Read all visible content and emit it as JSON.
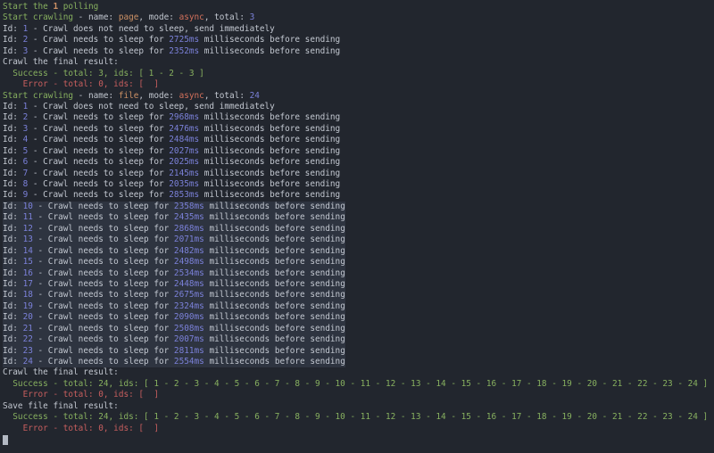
{
  "terminal": {
    "colors": {
      "background": "#22262e",
      "selection": "#2e3440",
      "text": "#c2c7d0",
      "green": "#87b05f",
      "orange": "#cd9165",
      "async": "#d3705b",
      "number": "#7b81d9",
      "red": "#c75e5e",
      "cursor": "#b3b9c3"
    },
    "lines": [
      {
        "segments": [
          {
            "text": "Start the ",
            "color": "green"
          },
          {
            "text": "1",
            "color": "orange",
            "bold": true
          },
          {
            "text": " polling",
            "color": "green"
          }
        ]
      },
      {
        "segments": [
          {
            "text": "Start crawling",
            "color": "green"
          },
          {
            "text": " - name: ",
            "color": "text"
          },
          {
            "text": "page",
            "color": "orange"
          },
          {
            "text": ", mode: ",
            "color": "text"
          },
          {
            "text": "async",
            "color": "async"
          },
          {
            "text": ", total: ",
            "color": "text"
          },
          {
            "text": "3",
            "color": "number"
          }
        ]
      },
      {
        "segments": [
          {
            "text": "Id: ",
            "color": "text"
          },
          {
            "text": "1",
            "color": "number"
          },
          {
            "text": " - Crawl does not need to sleep, send immediately",
            "color": "text"
          }
        ]
      },
      {
        "segments": [
          {
            "text": "Id: ",
            "color": "text"
          },
          {
            "text": "2",
            "color": "number"
          },
          {
            "text": " - Crawl needs to sleep for ",
            "color": "text"
          },
          {
            "text": "2725ms",
            "color": "number"
          },
          {
            "text": " milliseconds before sending",
            "color": "text"
          }
        ]
      },
      {
        "segments": [
          {
            "text": "Id: ",
            "color": "text"
          },
          {
            "text": "3",
            "color": "number"
          },
          {
            "text": " - Crawl needs to sleep for ",
            "color": "text"
          },
          {
            "text": "2352ms",
            "color": "number"
          },
          {
            "text": " milliseconds before sending",
            "color": "text"
          }
        ]
      },
      {
        "segments": [
          {
            "text": "Crawl the final result:",
            "color": "text"
          }
        ]
      },
      {
        "segments": [
          {
            "text": "  Success - total: 3, ids: [ 1 - 2 - 3 ]",
            "color": "green"
          }
        ]
      },
      {
        "segments": [
          {
            "text": "    Error - total: 0, ids: [  ]",
            "color": "red"
          }
        ]
      },
      {
        "segments": [
          {
            "text": "Start crawling",
            "color": "green"
          },
          {
            "text": " - name: ",
            "color": "text"
          },
          {
            "text": "file",
            "color": "orange"
          },
          {
            "text": ", mode: ",
            "color": "text"
          },
          {
            "text": "async",
            "color": "async"
          },
          {
            "text": ", total: ",
            "color": "text"
          },
          {
            "text": "24",
            "color": "number"
          }
        ]
      },
      {
        "segments": [
          {
            "text": "Id: ",
            "color": "text"
          },
          {
            "text": "1",
            "color": "number"
          },
          {
            "text": " - Crawl does not need to sleep, send immediately",
            "color": "text"
          }
        ]
      },
      {
        "segments": [
          {
            "text": "Id: ",
            "color": "text"
          },
          {
            "text": "2",
            "color": "number"
          },
          {
            "text": " - Crawl needs to sleep for ",
            "color": "text"
          },
          {
            "text": "2968ms",
            "color": "number"
          },
          {
            "text": " milliseconds before sending",
            "color": "text"
          }
        ]
      },
      {
        "segments": [
          {
            "text": "Id: ",
            "color": "text"
          },
          {
            "text": "3",
            "color": "number"
          },
          {
            "text": " - Crawl needs to sleep for ",
            "color": "text"
          },
          {
            "text": "2476ms",
            "color": "number"
          },
          {
            "text": " milliseconds before sending",
            "color": "text"
          }
        ]
      },
      {
        "segments": [
          {
            "text": "Id: ",
            "color": "text"
          },
          {
            "text": "4",
            "color": "number"
          },
          {
            "text": " - Crawl needs to sleep for ",
            "color": "text"
          },
          {
            "text": "2484ms",
            "color": "number"
          },
          {
            "text": " milliseconds before sending",
            "color": "text"
          }
        ]
      },
      {
        "segments": [
          {
            "text": "Id: ",
            "color": "text"
          },
          {
            "text": "5",
            "color": "number"
          },
          {
            "text": " - Crawl needs to sleep for ",
            "color": "text"
          },
          {
            "text": "2027ms",
            "color": "number"
          },
          {
            "text": " milliseconds before sending",
            "color": "text"
          }
        ]
      },
      {
        "segments": [
          {
            "text": "Id: ",
            "color": "text"
          },
          {
            "text": "6",
            "color": "number"
          },
          {
            "text": " - Crawl needs to sleep for ",
            "color": "text"
          },
          {
            "text": "2025ms",
            "color": "number"
          },
          {
            "text": " milliseconds before sending",
            "color": "text"
          }
        ]
      },
      {
        "segments": [
          {
            "text": "Id: ",
            "color": "text"
          },
          {
            "text": "7",
            "color": "number"
          },
          {
            "text": " - Crawl needs to sleep for ",
            "color": "text"
          },
          {
            "text": "2145ms",
            "color": "number"
          },
          {
            "text": " milliseconds before sending",
            "color": "text"
          }
        ]
      },
      {
        "segments": [
          {
            "text": "Id: ",
            "color": "text"
          },
          {
            "text": "8",
            "color": "number"
          },
          {
            "text": " - Crawl needs to sleep for ",
            "color": "text"
          },
          {
            "text": "2035ms",
            "color": "number"
          },
          {
            "text": " milliseconds before sending",
            "color": "text"
          }
        ]
      },
      {
        "segments": [
          {
            "text": "Id: ",
            "color": "text"
          },
          {
            "text": "9",
            "color": "number"
          },
          {
            "text": " - Crawl needs to sleep for ",
            "color": "text"
          },
          {
            "text": "2853ms",
            "color": "number"
          },
          {
            "text": " milliseconds before sending",
            "color": "text"
          }
        ]
      },
      {
        "selected": true,
        "segments": [
          {
            "text": "Id: ",
            "color": "text"
          },
          {
            "text": "10",
            "color": "number"
          },
          {
            "text": " - Crawl needs to sleep for ",
            "color": "text"
          },
          {
            "text": "2358ms",
            "color": "number"
          },
          {
            "text": " milliseconds before sending",
            "color": "text"
          }
        ]
      },
      {
        "selected": true,
        "segments": [
          {
            "text": "Id: ",
            "color": "text"
          },
          {
            "text": "11",
            "color": "number"
          },
          {
            "text": " - Crawl needs to sleep for ",
            "color": "text"
          },
          {
            "text": "2435ms",
            "color": "number"
          },
          {
            "text": " milliseconds before sending",
            "color": "text"
          }
        ]
      },
      {
        "selected": true,
        "segments": [
          {
            "text": "Id: ",
            "color": "text"
          },
          {
            "text": "12",
            "color": "number"
          },
          {
            "text": " - Crawl needs to sleep for ",
            "color": "text"
          },
          {
            "text": "2868ms",
            "color": "number"
          },
          {
            "text": " milliseconds before sending",
            "color": "text"
          }
        ]
      },
      {
        "selected": true,
        "segments": [
          {
            "text": "Id: ",
            "color": "text"
          },
          {
            "text": "13",
            "color": "number"
          },
          {
            "text": " - Crawl needs to sleep for ",
            "color": "text"
          },
          {
            "text": "2071ms",
            "color": "number"
          },
          {
            "text": " milliseconds before sending",
            "color": "text"
          }
        ]
      },
      {
        "selected": true,
        "segments": [
          {
            "text": "Id: ",
            "color": "text"
          },
          {
            "text": "14",
            "color": "number"
          },
          {
            "text": " - Crawl needs to sleep for ",
            "color": "text"
          },
          {
            "text": "2482ms",
            "color": "number"
          },
          {
            "text": " milliseconds before sending",
            "color": "text"
          }
        ]
      },
      {
        "selected": true,
        "segments": [
          {
            "text": "Id: ",
            "color": "text"
          },
          {
            "text": "15",
            "color": "number"
          },
          {
            "text": " - Crawl needs to sleep for ",
            "color": "text"
          },
          {
            "text": "2498ms",
            "color": "number"
          },
          {
            "text": " milliseconds before sending",
            "color": "text"
          }
        ]
      },
      {
        "selected": true,
        "segments": [
          {
            "text": "Id: ",
            "color": "text"
          },
          {
            "text": "16",
            "color": "number"
          },
          {
            "text": " - Crawl needs to sleep for ",
            "color": "text"
          },
          {
            "text": "2534ms",
            "color": "number"
          },
          {
            "text": " milliseconds before sending",
            "color": "text"
          }
        ]
      },
      {
        "selected": true,
        "segments": [
          {
            "text": "Id: ",
            "color": "text"
          },
          {
            "text": "17",
            "color": "number"
          },
          {
            "text": " - Crawl needs to sleep for ",
            "color": "text"
          },
          {
            "text": "2448ms",
            "color": "number"
          },
          {
            "text": " milliseconds before sending",
            "color": "text"
          }
        ]
      },
      {
        "selected": true,
        "segments": [
          {
            "text": "Id: ",
            "color": "text"
          },
          {
            "text": "18",
            "color": "number"
          },
          {
            "text": " - Crawl needs to sleep for ",
            "color": "text"
          },
          {
            "text": "2675ms",
            "color": "number"
          },
          {
            "text": " milliseconds before sending",
            "color": "text"
          }
        ]
      },
      {
        "selected": true,
        "segments": [
          {
            "text": "Id: ",
            "color": "text"
          },
          {
            "text": "19",
            "color": "number"
          },
          {
            "text": " - Crawl needs to sleep for ",
            "color": "text"
          },
          {
            "text": "2324ms",
            "color": "number"
          },
          {
            "text": " milliseconds before sending",
            "color": "text"
          }
        ]
      },
      {
        "selected": true,
        "segments": [
          {
            "text": "Id: ",
            "color": "text"
          },
          {
            "text": "20",
            "color": "number"
          },
          {
            "text": " - Crawl needs to sleep for ",
            "color": "text"
          },
          {
            "text": "2090ms",
            "color": "number"
          },
          {
            "text": " milliseconds before sending",
            "color": "text"
          }
        ]
      },
      {
        "selected": true,
        "segments": [
          {
            "text": "Id: ",
            "color": "text"
          },
          {
            "text": "21",
            "color": "number"
          },
          {
            "text": " - Crawl needs to sleep for ",
            "color": "text"
          },
          {
            "text": "2508ms",
            "color": "number"
          },
          {
            "text": " milliseconds before sending",
            "color": "text"
          }
        ]
      },
      {
        "selected": true,
        "segments": [
          {
            "text": "Id: ",
            "color": "text"
          },
          {
            "text": "22",
            "color": "number"
          },
          {
            "text": " - Crawl needs to sleep for ",
            "color": "text"
          },
          {
            "text": "2007ms",
            "color": "number"
          },
          {
            "text": " milliseconds before sending",
            "color": "text"
          }
        ]
      },
      {
        "selected": true,
        "segments": [
          {
            "text": "Id: ",
            "color": "text"
          },
          {
            "text": "23",
            "color": "number"
          },
          {
            "text": " - Crawl needs to sleep for ",
            "color": "text"
          },
          {
            "text": "2811ms",
            "color": "number"
          },
          {
            "text": " milliseconds before sending",
            "color": "text"
          }
        ]
      },
      {
        "selected": true,
        "segments": [
          {
            "text": "Id: ",
            "color": "text"
          },
          {
            "text": "24",
            "color": "number"
          },
          {
            "text": " - Crawl needs to sleep for ",
            "color": "text"
          },
          {
            "text": "2554ms",
            "color": "number"
          },
          {
            "text": " milliseconds before sending",
            "color": "text"
          }
        ]
      },
      {
        "segments": [
          {
            "text": "Crawl the final result:",
            "color": "text"
          }
        ]
      },
      {
        "segments": [
          {
            "text": "  Success - total: 24, ids: [ 1 - 2 - 3 - 4 - 5 - 6 - 7 - 8 - 9 - 10 - 11 - 12 - 13 - 14 - 15 - 16 - 17 - 18 - 19 - 20 - 21 - 22 - 23 - 24 ]",
            "color": "green"
          }
        ]
      },
      {
        "segments": [
          {
            "text": "    Error - total: 0, ids: [  ]",
            "color": "red"
          }
        ]
      },
      {
        "segments": [
          {
            "text": "Save file final result:",
            "color": "text"
          }
        ]
      },
      {
        "segments": [
          {
            "text": "  Success - total: 24, ids: [ 1 - 2 - 3 - 4 - 5 - 6 - 7 - 8 - 9 - 10 - 11 - 12 - 13 - 14 - 15 - 16 - 17 - 18 - 19 - 20 - 21 - 22 - 23 - 24 ]",
            "color": "green"
          }
        ]
      },
      {
        "segments": [
          {
            "text": "    Error - total: 0, ids: [  ]",
            "color": "red"
          }
        ]
      }
    ],
    "cursor_visible": true
  }
}
